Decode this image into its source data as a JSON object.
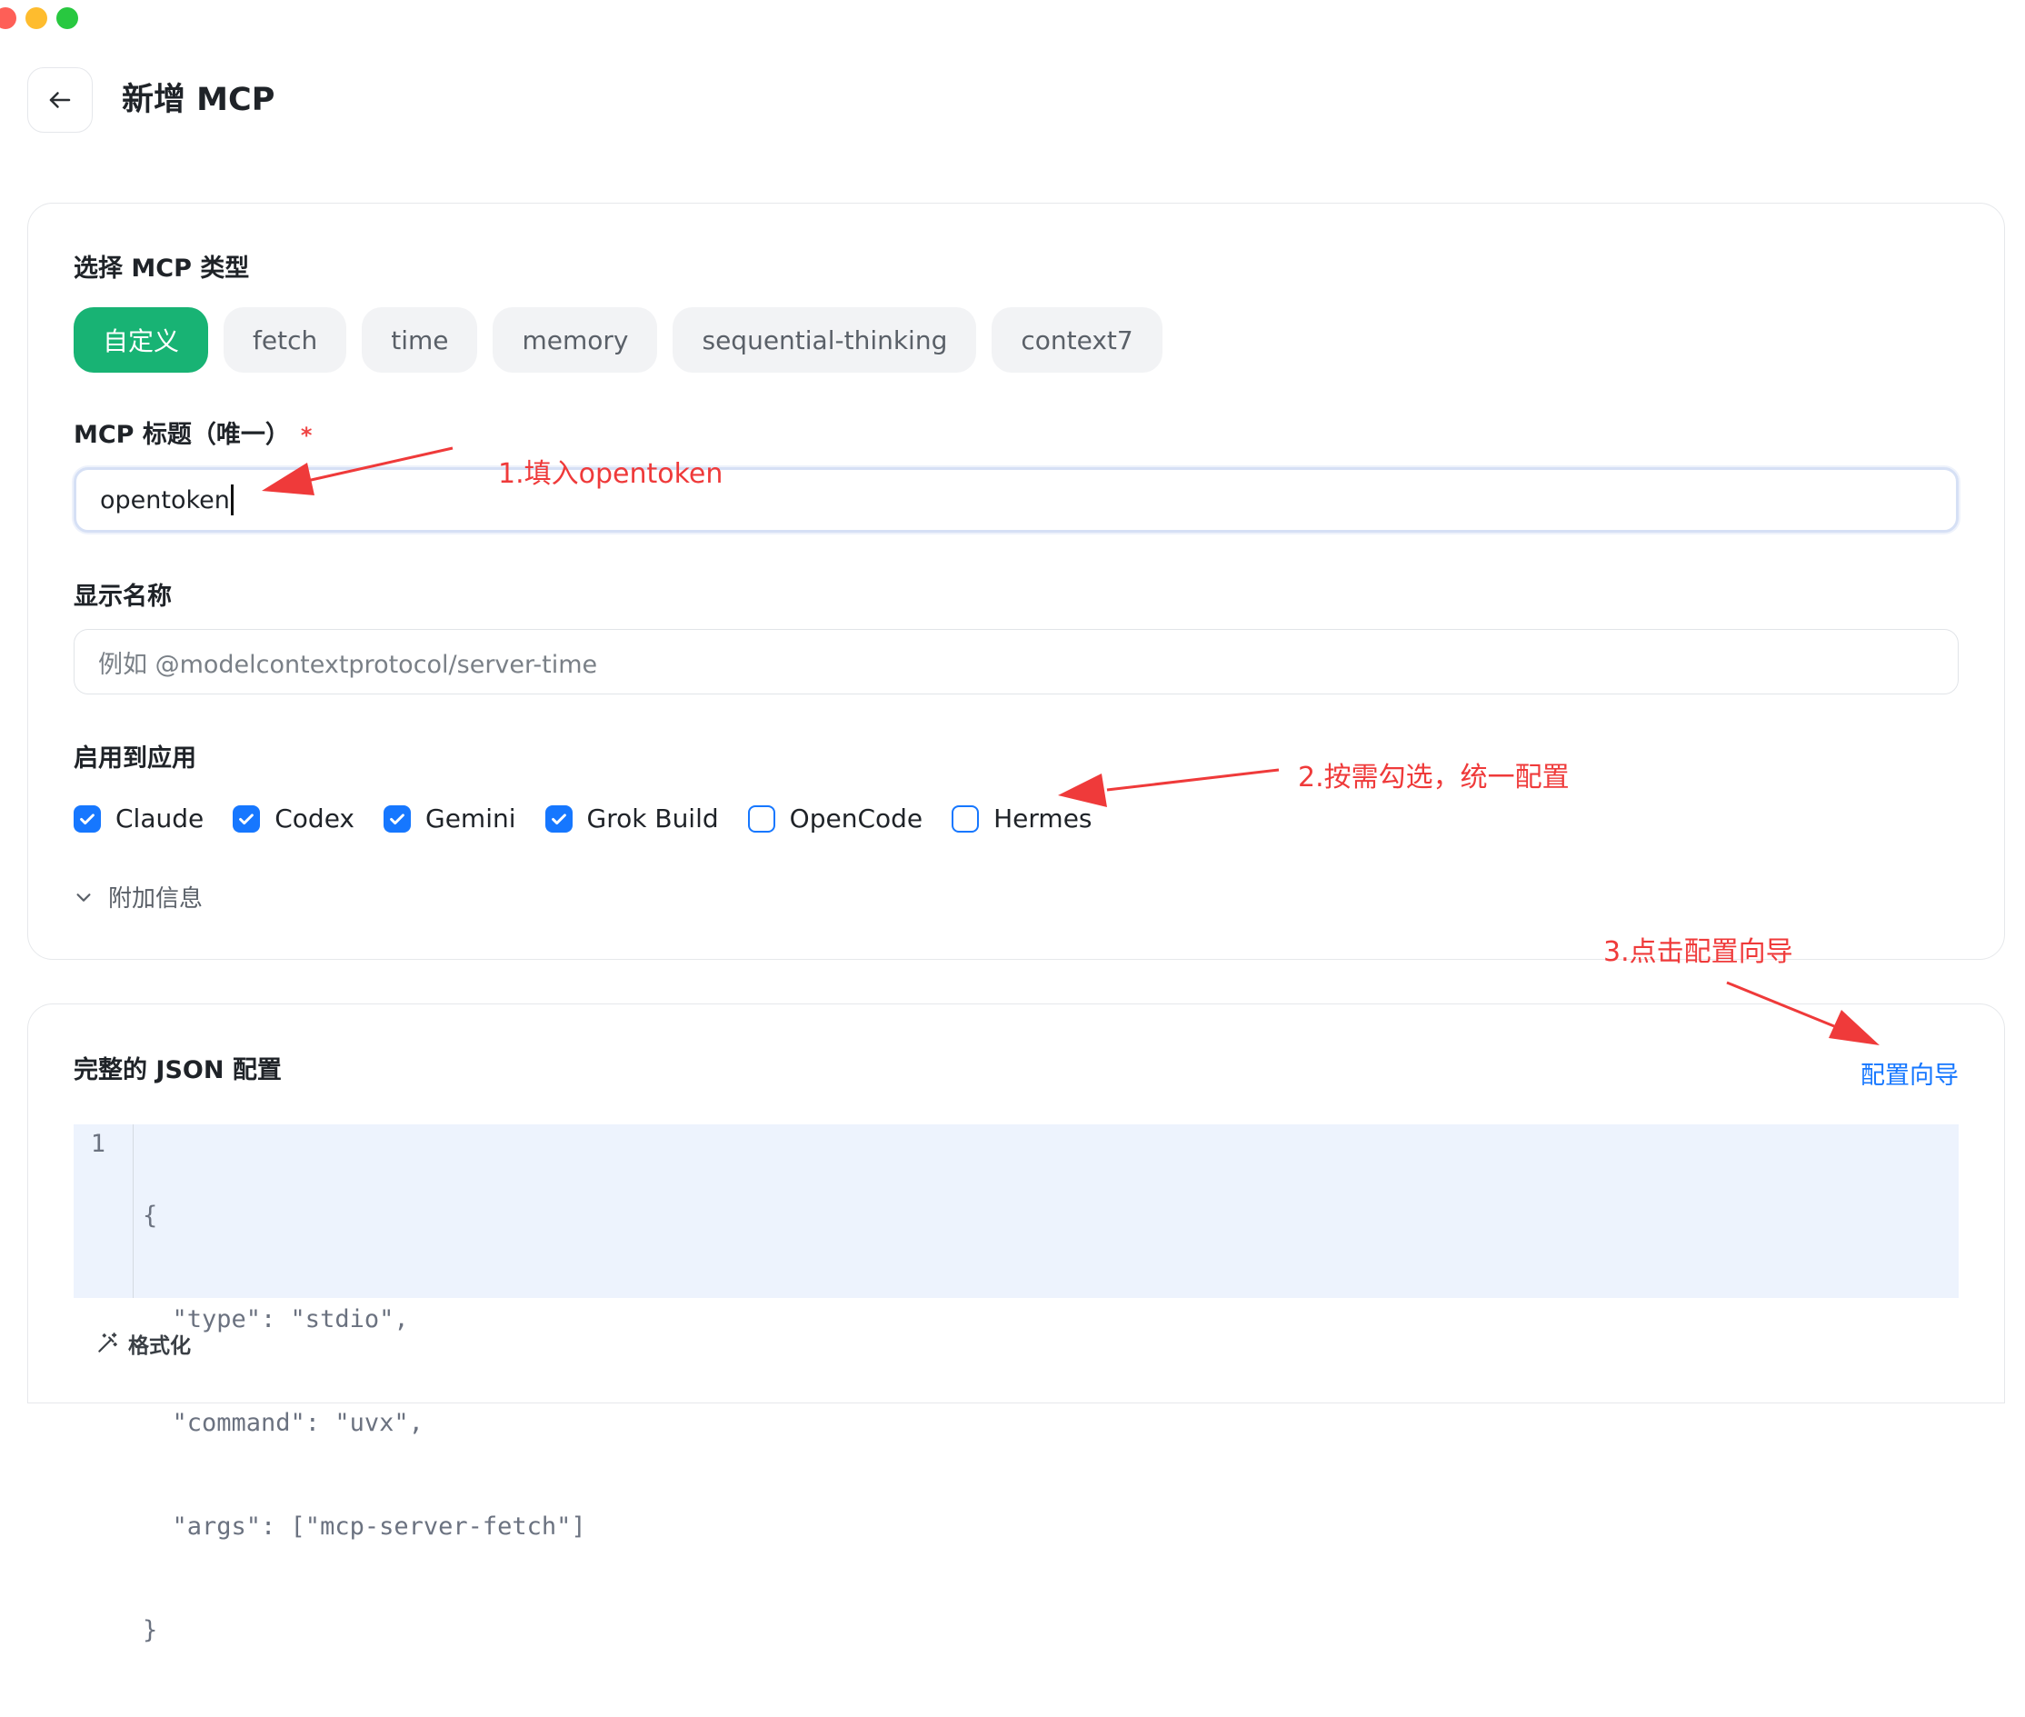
{
  "window": {
    "controls": [
      "close",
      "minimize",
      "maximize"
    ]
  },
  "header": {
    "back_icon": "arrow-left-icon",
    "title": "新增 MCP"
  },
  "type_section": {
    "label": "选择 MCP 类型",
    "options": [
      "自定义",
      "fetch",
      "time",
      "memory",
      "sequential-thinking",
      "context7"
    ],
    "selected": "自定义"
  },
  "title_field": {
    "label": "MCP 标题（唯一）",
    "required_mark": "*",
    "value": "opentoken"
  },
  "display_name": {
    "label": "显示名称",
    "placeholder": "例如 @modelcontextprotocol/server-time"
  },
  "apps": {
    "label": "启用到应用",
    "items": [
      {
        "name": "Claude",
        "checked": true
      },
      {
        "name": "Codex",
        "checked": true
      },
      {
        "name": "Gemini",
        "checked": true
      },
      {
        "name": "Grok Build",
        "checked": true
      },
      {
        "name": "OpenCode",
        "checked": false
      },
      {
        "name": "Hermes",
        "checked": false
      }
    ]
  },
  "extra_info": {
    "label": "附加信息",
    "icon": "chevron-down-icon"
  },
  "json_config": {
    "label": "完整的 JSON 配置",
    "wizard_link": "配置向导",
    "line_number": "1",
    "code_lines": [
      "{",
      "  \"type\": \"stdio\",",
      "  \"command\": \"uvx\",",
      "  \"args\": [\"mcp-server-fetch\"]",
      "}"
    ],
    "format_label": "格式化",
    "format_icon": "magic-wand-icon"
  },
  "annotations": {
    "step1": "1.填入opentoken",
    "step2": "2.按需勾选，统一配置",
    "step3": "3.点击配置向导",
    "color": "#ef3a3a"
  },
  "colors": {
    "accent_green": "#18b374",
    "accent_blue": "#1677ff",
    "code_bg": "#edf3fd"
  }
}
